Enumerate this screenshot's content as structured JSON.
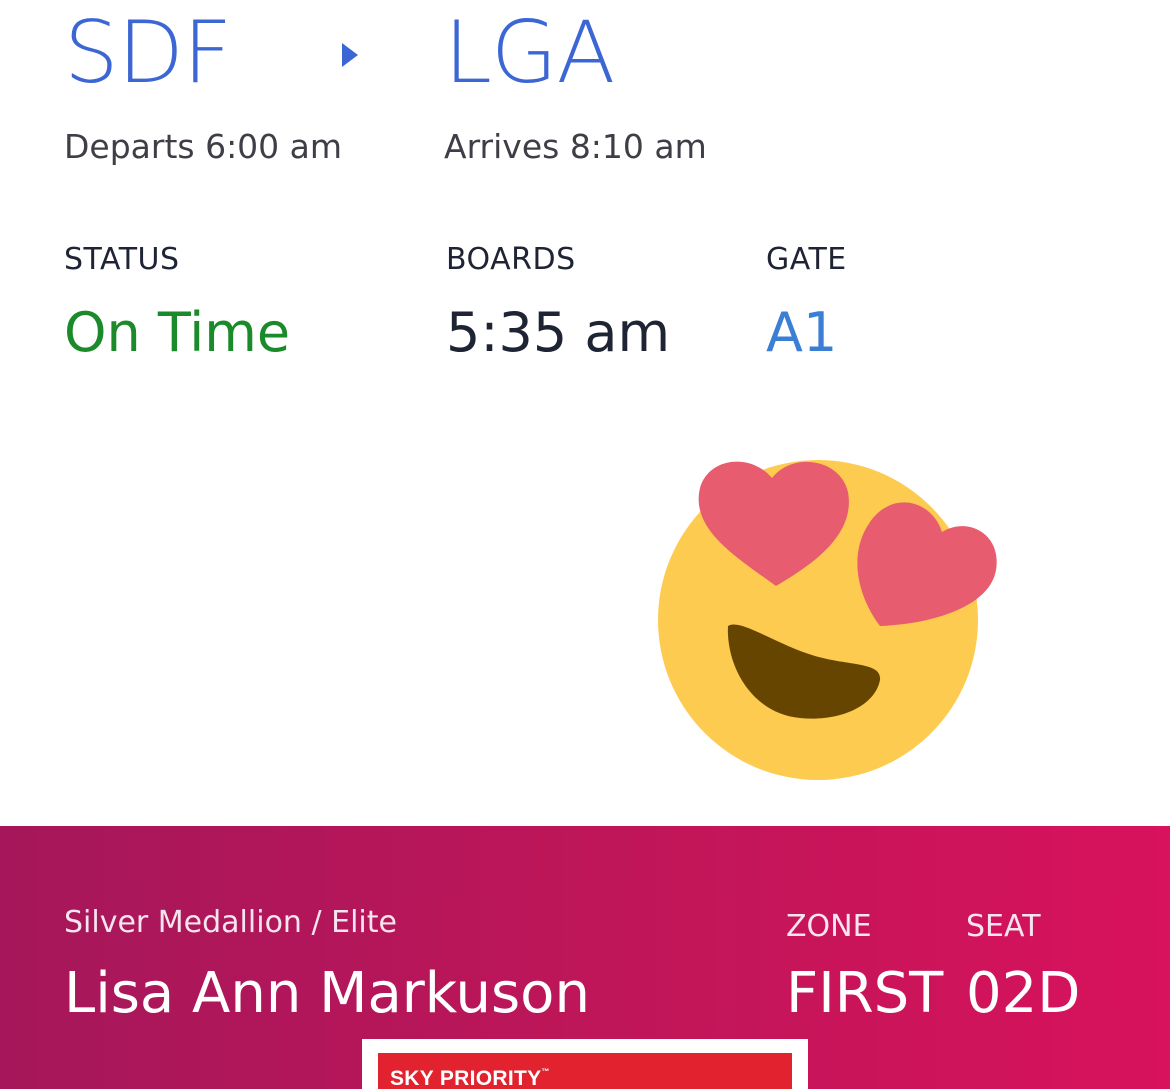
{
  "route": {
    "origin": "SDF",
    "destination": "LGA",
    "departs": "Departs 6:00 am",
    "arrives": "Arrives 8:10 am"
  },
  "info": {
    "status_label": "STATUS",
    "status_value": "On Time",
    "boards_label": "BOARDS",
    "boards_value": "5:35 am",
    "gate_label": "GATE",
    "gate_value": "A1"
  },
  "emoji": {
    "icon": "heart-eyes-emoji-icon"
  },
  "passenger_banner": {
    "tier": "Silver Medallion / Elite",
    "name": "Lisa Ann Markuson",
    "zone_label": "ZONE",
    "zone_value": "FIRST",
    "seat_label": "SEAT",
    "seat_value": "02D"
  },
  "badge": {
    "text": "SKY PRIORITY",
    "tm": "™"
  },
  "colors": {
    "accent_blue": "#3b66d4",
    "status_green": "#1a8a2a",
    "banner_magenta": "#c01659",
    "sky_priority_red": "#e2232f"
  }
}
